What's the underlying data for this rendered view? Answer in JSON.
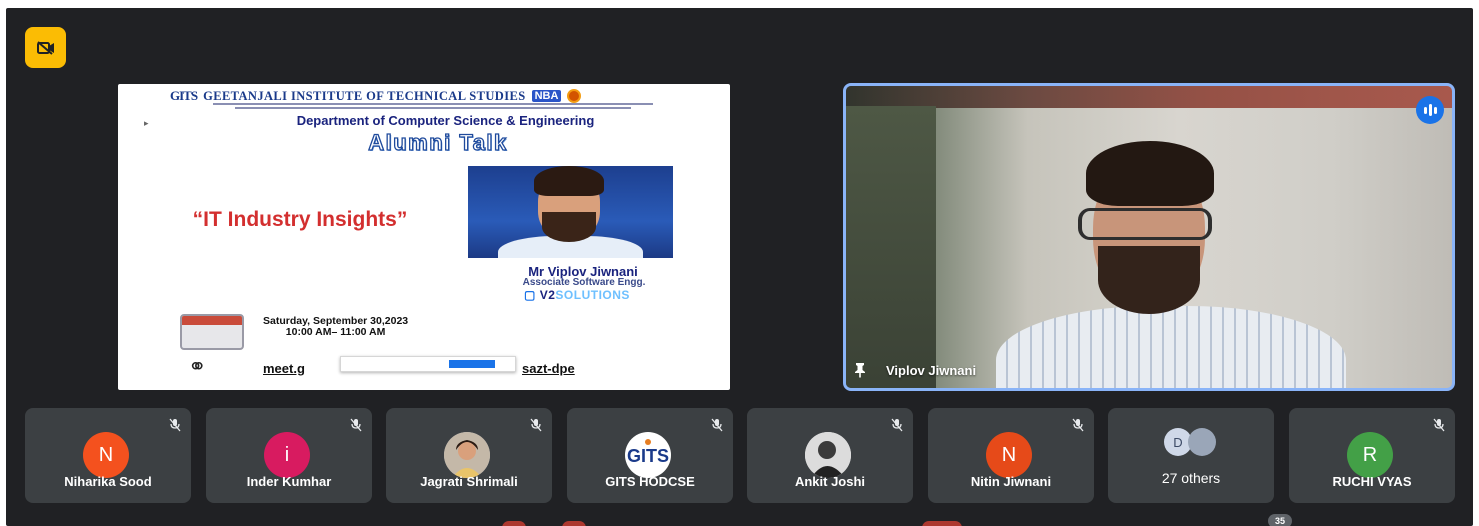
{
  "meeting": {
    "camera_off_icon": "video-off-icon",
    "accent_camera": "#fbbc04",
    "participant_count_badge": "35"
  },
  "slide": {
    "institute_logo": "GITS",
    "institute_name": "GEETANJALI INSTITUTE OF TECHNICAL STUDIES",
    "accreditation_badge": "NBA",
    "department": "Department of Computer Science & Engineering",
    "event_type": "Alumni Talk",
    "talk_title": "“IT Industry Insights”",
    "speaker_name": "Mr Viplov Jiwnani",
    "speaker_role": "Associate Software Engg.",
    "company_prefix": "V2",
    "company_suffix": "SOLUTIONS",
    "date_line": "Saturday, September 30,2023",
    "time_line": "10:00 AM– 11:00 AM",
    "meet_link_start": "meet.g",
    "meet_link_end": "sazt-dpe"
  },
  "speaker_tile": {
    "name": "Viplov Jiwnani",
    "pin_icon": "pin-icon",
    "speaking_icon": "audio-level-icon",
    "border_color": "#8ab4f8"
  },
  "participants": [
    {
      "name": "Niharika Sood",
      "initial": "N",
      "color": "#f4511e"
    },
    {
      "name": "Inder Kumhar",
      "initial": "i",
      "color": "#d81b60"
    },
    {
      "name": "Jagrati Shrimali",
      "initial": "",
      "color": "#b0b7c3"
    },
    {
      "name": "GITS HODCSE",
      "initial": "",
      "color": "#ffffff"
    },
    {
      "name": "Ankit Joshi",
      "initial": "",
      "color": "#e5e5e5"
    },
    {
      "name": "Nitin Jiwnani",
      "initial": "N",
      "color": "#e64a19"
    },
    {
      "name": "RUCHI VYAS",
      "initial": "R",
      "color": "#43a047"
    }
  ],
  "others_tile": {
    "label": "27 others",
    "avatar_initial": "D"
  }
}
